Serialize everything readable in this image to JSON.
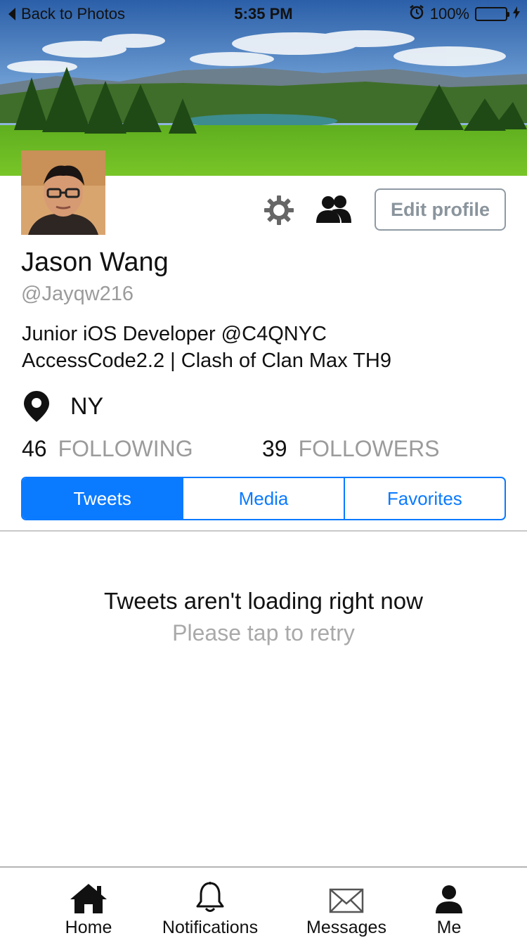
{
  "status_bar": {
    "back_label": "Back to Photos",
    "time": "5:35 PM",
    "battery": "100%"
  },
  "profile": {
    "name": "Jason Wang",
    "handle": "@Jayqw216",
    "bio_line1": "Junior iOS Developer @C4QNYC",
    "bio_line2": "AccessCode2.2 | Clash of Clan Max TH9",
    "location": "NY",
    "edit_label": "Edit profile"
  },
  "stats": {
    "following_count": "46",
    "following_label": "FOLLOWING",
    "followers_count": "39",
    "followers_label": "FOLLOWERS"
  },
  "segments": {
    "tweets": "Tweets",
    "media": "Media",
    "favorites": "Favorites",
    "selected": "Tweets"
  },
  "empty_state": {
    "title": "Tweets aren't loading right now",
    "subtitle": "Please tap to retry"
  },
  "tabbar": {
    "home": "Home",
    "notifications": "Notifications",
    "messages": "Messages",
    "me": "Me"
  },
  "colors": {
    "accent": "#0a7aff",
    "muted_text": "#9b9b9b",
    "battery_green": "#4cd964"
  },
  "icons": [
    "gear-icon",
    "people-icon",
    "location-pin-icon",
    "home-icon",
    "bell-icon",
    "envelope-icon",
    "person-icon"
  ]
}
